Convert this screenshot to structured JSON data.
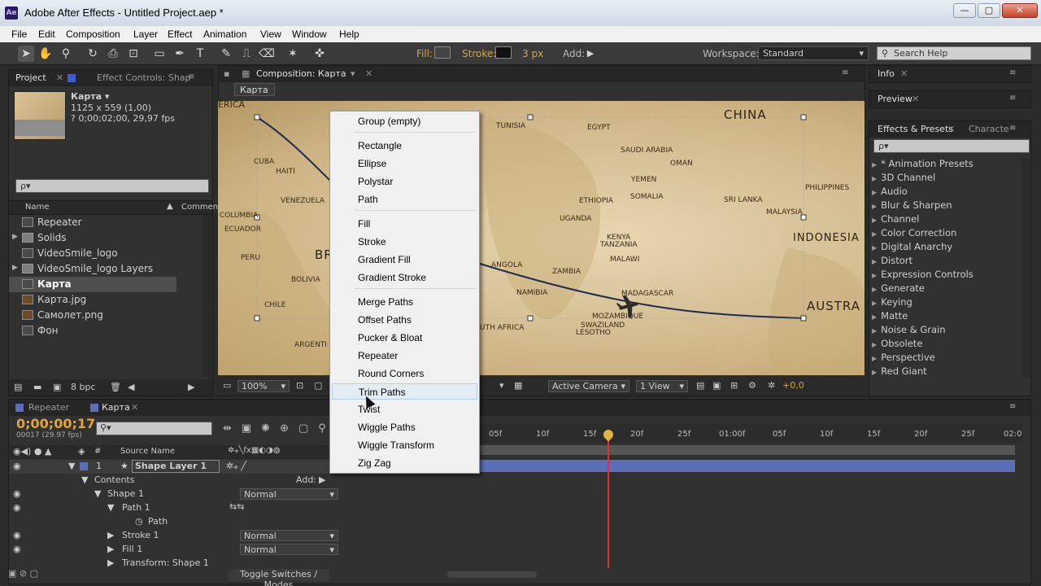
{
  "app": {
    "title": "Adobe After Effects - Untitled Project.aep *",
    "icon_text": "Ae"
  },
  "window_controls": {
    "minimize": "—",
    "maximize": "▢",
    "close": "✕"
  },
  "menubar": [
    "File",
    "Edit",
    "Composition",
    "Layer",
    "Effect",
    "Animation",
    "View",
    "Window",
    "Help"
  ],
  "toolbar": {
    "fill_label": "Fill:",
    "stroke_label": "Stroke:",
    "stroke_width": "3 px",
    "add_label": "Add:",
    "workspace_label": "Workspace:",
    "workspace_value": "Standard",
    "search_help": "Search Help"
  },
  "project_panel": {
    "tab_project": "Project",
    "tab_effect_controls": "Effect Controls: Shap",
    "selected_name": "Карта ▾",
    "selected_size": "1125 x 559 (1,00)",
    "selected_duration": "? 0;00;02;00, 29,97 fps",
    "search_placeholder": "ρ▾",
    "col_name": "Name",
    "col_comment": "Commen",
    "items": [
      {
        "name": "Repeater",
        "type": "comp",
        "expander": ""
      },
      {
        "name": "Solids",
        "type": "folder",
        "expander": "▶"
      },
      {
        "name": "VideoSmile_logo",
        "type": "comp",
        "expander": ""
      },
      {
        "name": "VideoSmile_logo Layers",
        "type": "folder",
        "expander": "▶"
      },
      {
        "name": "Карта",
        "type": "comp",
        "expander": ""
      },
      {
        "name": "Карта.jpg",
        "type": "img",
        "expander": ""
      },
      {
        "name": "Самолет.png",
        "type": "img",
        "expander": ""
      },
      {
        "name": "Фон",
        "type": "comp",
        "expander": ""
      }
    ],
    "bpc": "8 bpc"
  },
  "composition_panel": {
    "tab": "Composition: Карта",
    "breadcrumb": "Карта",
    "zoom": "100%",
    "camera": "Active Camera",
    "views": "1 View",
    "exposure": "+0,0",
    "map_labels": [
      "ERICA",
      "CHINA",
      "CUBA",
      "HAITI",
      "VENEZUELA",
      "COLUMBIA",
      "ECUADOR",
      "PERU",
      "BOLIVIA",
      "CHILE",
      "ARGENTI",
      "BR",
      "TUNISIA",
      "EGYPT",
      "SAUDI ARABIA",
      "YEMEN",
      "OMAN",
      "ETHIOPIA",
      "SOMALIA",
      "SRI LANKA",
      "PHILIPPINES",
      "MALAYSIA",
      "INDONESIA",
      "UGANDA",
      "KENYA",
      "TANZANIA",
      "MALAWI",
      "ZAMBIA",
      "ANGOLA",
      "NAMIBIA",
      "MADAGASCAR",
      "MOZAMBIQUE",
      "SWAZILAND",
      "LESOTHO",
      "UTH AFRICA",
      "AUSTRA"
    ]
  },
  "info_panel": {
    "tab": "Info"
  },
  "preview_panel": {
    "tab": "Preview"
  },
  "effects_panel": {
    "tab": "Effects & Presets",
    "tab2": "Characte",
    "search_placeholder": "ρ▾",
    "items": [
      "* Animation Presets",
      "3D Channel",
      "Audio",
      "Blur & Sharpen",
      "Channel",
      "Color Correction",
      "Digital Anarchy",
      "Distort",
      "Expression Controls",
      "Generate",
      "Keying",
      "Matte",
      "Noise & Grain",
      "Obsolete",
      "Perspective",
      "Red Giant"
    ]
  },
  "timeline": {
    "tab_repeater": "Repeater",
    "tab_karta": "Карта",
    "timecode": "0;00;00;17",
    "frames": "00017 (29.97 fps)",
    "col_source": "Source Name",
    "ruler_ticks": [
      "05f",
      "10f",
      "15f",
      "20f",
      "25f",
      "01:00f",
      "05f",
      "10f",
      "15f",
      "20f",
      "25f",
      "02:0"
    ],
    "layers": [
      {
        "num": "1",
        "name": "Shape Layer 1",
        "indent": 0,
        "mode": ""
      },
      {
        "num": "",
        "name": "Contents",
        "indent": 1,
        "mode": "",
        "add": "Add:"
      },
      {
        "num": "",
        "name": "Shape 1",
        "indent": 2,
        "mode": "Normal"
      },
      {
        "num": "",
        "name": "Path 1",
        "indent": 3,
        "mode": ""
      },
      {
        "num": "",
        "name": "Path",
        "indent": 4,
        "mode": ""
      },
      {
        "num": "",
        "name": "Stroke 1",
        "indent": 3,
        "mode": "Normal"
      },
      {
        "num": "",
        "name": "Fill 1",
        "indent": 3,
        "mode": "Normal"
      },
      {
        "num": "",
        "name": "Transform: Shape 1",
        "indent": 3,
        "mode": ""
      }
    ],
    "toggle_label": "Toggle Switches / Modes"
  },
  "context_menu": {
    "groups": [
      [
        "Group (empty)"
      ],
      [
        "Rectangle",
        "Ellipse",
        "Polystar",
        "Path"
      ],
      [
        "Fill",
        "Stroke",
        "Gradient Fill",
        "Gradient Stroke"
      ],
      [
        "Merge Paths",
        "Offset Paths",
        "Pucker & Bloat",
        "Repeater",
        "Round Corners",
        "Trim Paths",
        "Twist",
        "Wiggle Paths",
        "Wiggle Transform",
        "Zig Zag"
      ]
    ],
    "highlighted": "Trim Paths"
  }
}
